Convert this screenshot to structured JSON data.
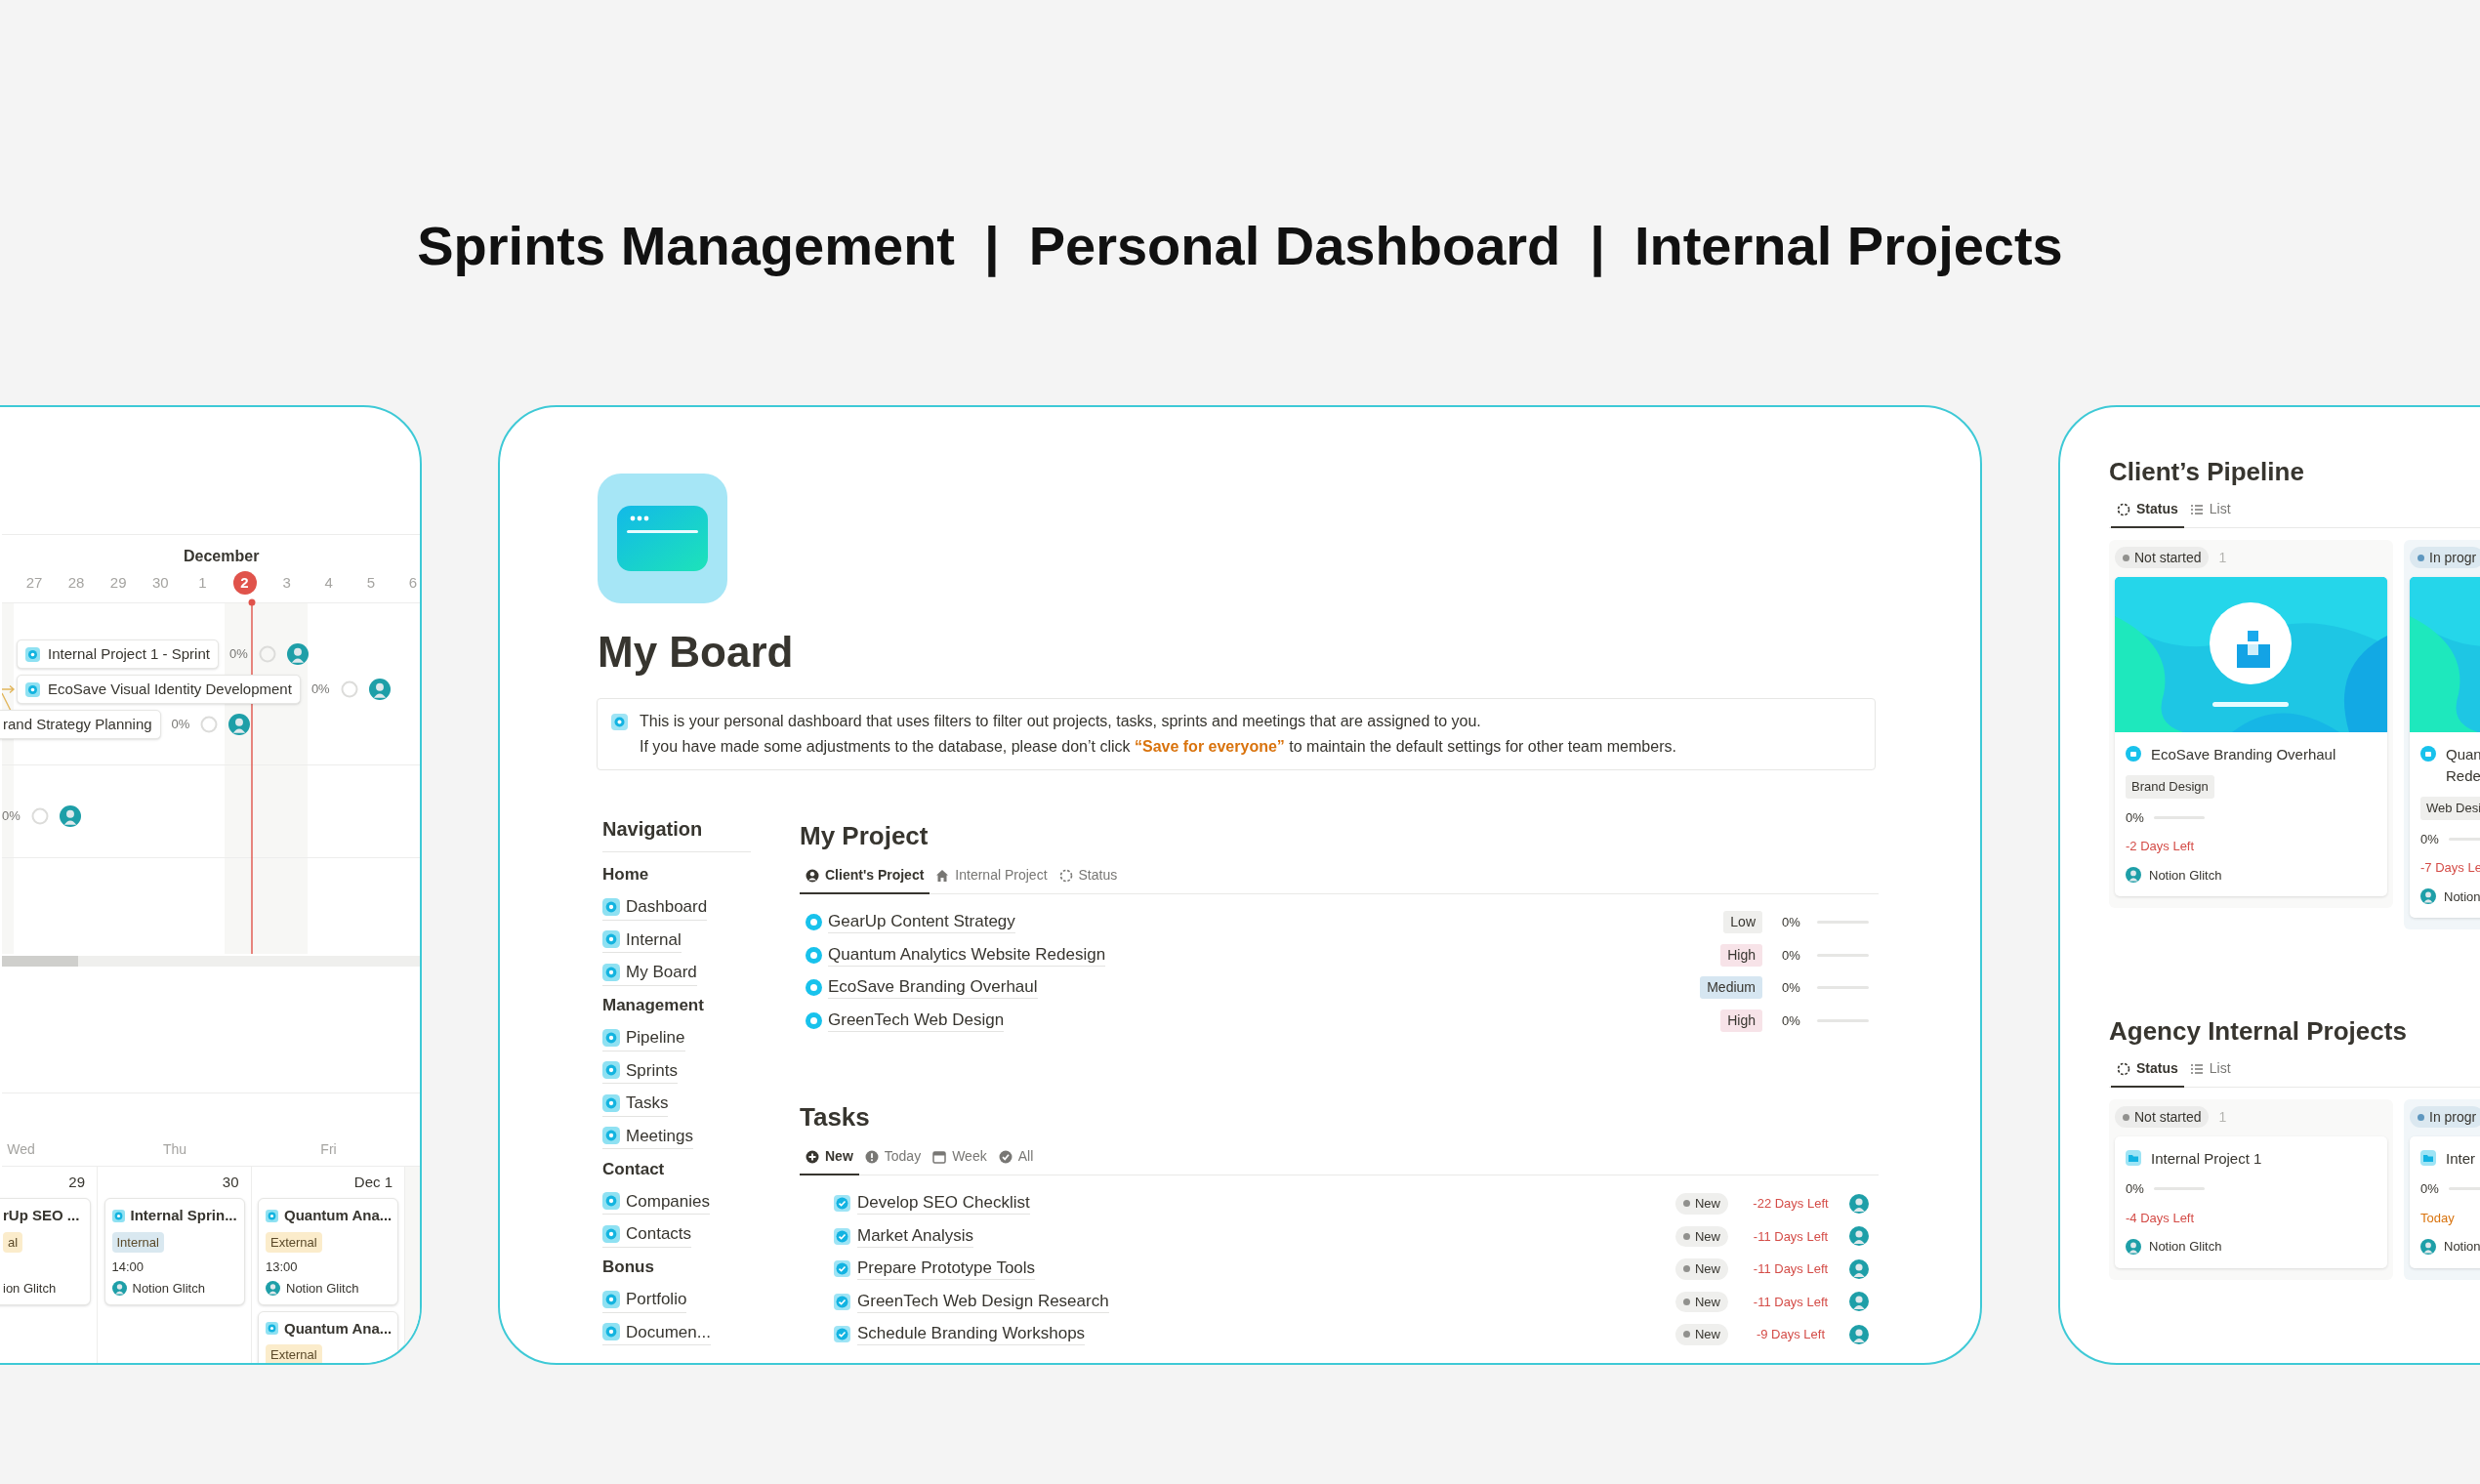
{
  "headline": [
    "Sprints Management",
    "|",
    "Personal Dashboard",
    "|",
    "Internal Projects"
  ],
  "sprints": {
    "month": "December",
    "days": [
      {
        "label": "27",
        "today": false
      },
      {
        "label": "28",
        "today": false
      },
      {
        "label": "29",
        "today": false
      },
      {
        "label": "30",
        "today": false
      },
      {
        "label": "1",
        "today": false
      },
      {
        "label": "2",
        "today": true
      },
      {
        "label": "3",
        "today": false
      },
      {
        "label": "4",
        "today": false
      },
      {
        "label": "5",
        "today": false
      },
      {
        "label": "6",
        "today": false
      }
    ],
    "bars": [
      {
        "title": "Internal Project 1 - Sprint",
        "progress": "0%"
      },
      {
        "title": "EcoSave Visual Identity Development",
        "progress": "0%"
      },
      {
        "title": "rand Strategy Planning",
        "progress": "0%"
      },
      {
        "progress": "0%"
      }
    ],
    "weekdays": [
      "Wed",
      "Thu",
      "Fri"
    ],
    "columns": [
      {
        "date": "29",
        "events": [
          {
            "title": "rUp SEO ...",
            "tag": "al",
            "color": "#fbeccb",
            "person": "ion Glitch",
            "avatar": false
          }
        ]
      },
      {
        "date": "30",
        "events": [
          {
            "title": "Internal Sprin...",
            "tag": "Internal",
            "color": "#d9e8f0",
            "time": "14:00",
            "person": "Notion Glitch",
            "avatar": true
          }
        ]
      },
      {
        "date": "Dec 1",
        "events": [
          {
            "title": "Quantum Ana...",
            "tag": "External",
            "color": "#fbeccb",
            "time": "13:00",
            "person": "Notion Glitch",
            "avatar": true
          },
          {
            "title": "Quantum Ana...",
            "tag": "External",
            "color": "#fbeccb"
          }
        ]
      }
    ]
  },
  "board": {
    "title": "My Board",
    "callout": [
      "This is your personal dashboard that uses filters to filter out projects, tasks, sprints and meetings that are assigned to you.",
      "If you have made some adjustments to the database, please don’t click **“Save for everyone”** to maintain the default settings for other team members."
    ],
    "navigation": {
      "title": "Navigation",
      "items": [
        {
          "label": "Home",
          "kind": "heading"
        },
        {
          "label": "Dashboard",
          "kind": "link"
        },
        {
          "label": "Internal",
          "kind": "link"
        },
        {
          "label": "My Board",
          "kind": "link"
        },
        {
          "label": "Management",
          "kind": "heading"
        },
        {
          "label": "Pipeline",
          "kind": "link"
        },
        {
          "label": "Sprints",
          "kind": "link"
        },
        {
          "label": "Tasks",
          "kind": "link"
        },
        {
          "label": "Meetings",
          "kind": "link"
        },
        {
          "label": "Contact",
          "kind": "heading"
        },
        {
          "label": "Companies",
          "kind": "link"
        },
        {
          "label": "Contacts",
          "kind": "link"
        },
        {
          "label": "Bonus",
          "kind": "heading"
        },
        {
          "label": "Portfolio",
          "kind": "link"
        },
        {
          "label": "Documen...",
          "kind": "link"
        }
      ]
    },
    "my_project": {
      "title": "My Project",
      "tabs": [
        {
          "label": "Client's Project",
          "selected": true
        },
        {
          "label": "Internal Project",
          "selected": false
        },
        {
          "label": "Status",
          "selected": false
        }
      ],
      "rows": [
        {
          "name": "GearUp Content Strategy",
          "priority": "Low",
          "color": "#efefed",
          "progress": "0%",
          "level": 0
        },
        {
          "name": "Quantum Analytics Website Redesign",
          "priority": "High",
          "color": "#f7e3e8",
          "progress": "0%",
          "level": 0
        },
        {
          "name": "EcoSave Branding Overhaul",
          "priority": "Medium",
          "color": "#d6e6f1",
          "progress": "0%",
          "level": 0
        },
        {
          "name": "GreenTech Web Design",
          "priority": "High",
          "color": "#f7e3e8",
          "progress": "0%",
          "level": 0
        }
      ]
    },
    "tasks": {
      "title": "Tasks",
      "tabs": [
        {
          "label": "New",
          "selected": true
        },
        {
          "label": "Today",
          "selected": false
        },
        {
          "label": "Week",
          "selected": false
        },
        {
          "label": "All",
          "selected": false
        }
      ],
      "rows": [
        {
          "name": "Develop SEO Checklist",
          "status": "New",
          "due": "-22 Days Left"
        },
        {
          "name": "Market Analysis",
          "status": "New",
          "due": "-11 Days Left"
        },
        {
          "name": "Prepare Prototype Tools",
          "status": "New",
          "due": "-11 Days Left"
        },
        {
          "name": "GreenTech Web Design Research",
          "status": "New",
          "due": "-11 Days Left"
        },
        {
          "name": "Schedule Branding Workshops",
          "status": "New",
          "due": "-9 Days Left"
        }
      ]
    }
  },
  "boards": [
    {
      "title": "Client’s Pipeline",
      "tabs": [
        {
          "label": "Status",
          "selected": true
        },
        {
          "label": "List",
          "selected": false
        }
      ],
      "groups": [
        {
          "label": "Not started",
          "count": "1",
          "color": "#91918e",
          "cards": [
            {
              "cover": true,
              "title_lines": [
                "EcoSave Branding Overhaul"
              ],
              "tag": "Brand Design",
              "progress": "0%",
              "level": 0,
              "due": "-2 Days Left",
              "color": "#d44c47",
              "person": "Notion Glitch"
            }
          ]
        },
        {
          "label": "In progr",
          "color": "#5e97bf",
          "cards": [
            {
              "cover": true,
              "title_lines": [
                "Quan",
                "Rede"
              ],
              "tag": "Web Desi",
              "progress": "0%",
              "level": 0,
              "due": "-7 Days Le",
              "color": "#d44c47",
              "person": "Notion"
            }
          ]
        }
      ]
    },
    {
      "title": "Agency Internal Projects",
      "tabs": [
        {
          "label": "Status",
          "selected": true
        },
        {
          "label": "List",
          "selected": false
        }
      ],
      "groups": [
        {
          "label": "Not started",
          "count": "1",
          "color": "#91918e",
          "cards": [
            {
              "title_lines": [
                "Internal Project 1"
              ],
              "progress": "0%",
              "level": 0,
              "due": "-4 Days Left",
              "color": "#d44c47",
              "person": "Notion Glitch"
            }
          ]
        },
        {
          "label": "In progr",
          "color": "#5e97bf",
          "cards": [
            {
              "title_lines": [
                "Inter"
              ],
              "progress": "0%",
              "level": 0,
              "due": "Today",
              "color": "#d9730d",
              "person": "Notion"
            }
          ]
        }
      ]
    }
  ]
}
